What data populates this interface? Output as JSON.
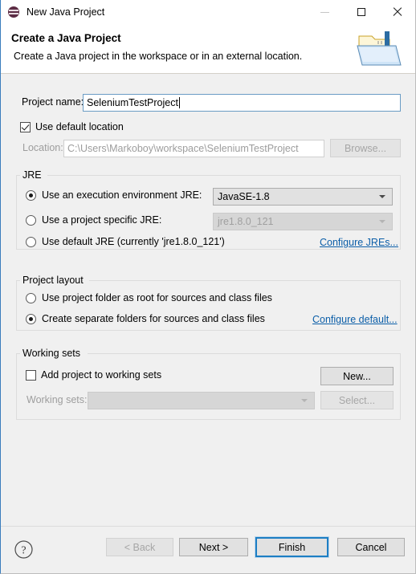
{
  "window": {
    "title": "New Java Project",
    "icon": "eclipse-logo-icon",
    "controls": {
      "minimize": "minimize-icon",
      "maximize": "maximize-icon",
      "close": "close-icon"
    }
  },
  "header": {
    "title": "Create a Java Project",
    "description": "Create a Java project in the workspace or in an external location.",
    "icon": "java-project-folder-icon"
  },
  "project_name": {
    "label": "Project name:",
    "value": "SeleniumTestProject"
  },
  "default_location": {
    "label": "Use default location",
    "checked": true
  },
  "location": {
    "label": "Location:",
    "value": "C:\\Users\\Markoboy\\workspace\\SeleniumTestProject",
    "browse_label": "Browse...",
    "enabled": false
  },
  "jre": {
    "legend": "JRE",
    "options": [
      {
        "label": "Use an execution environment JRE:",
        "selected": true
      },
      {
        "label": "Use a project specific JRE:",
        "selected": false
      },
      {
        "label": "Use default JRE (currently 'jre1.8.0_121')",
        "selected": false
      }
    ],
    "execution_environment": {
      "value": "JavaSE-1.8",
      "enabled": true
    },
    "specific_jre": {
      "value": "jre1.8.0_121",
      "enabled": false
    },
    "configure_link": "Configure JREs..."
  },
  "project_layout": {
    "legend": "Project layout",
    "options": [
      {
        "label": "Use project folder as root for sources and class files",
        "selected": false
      },
      {
        "label": "Create separate folders for sources and class files",
        "selected": true
      }
    ],
    "configure_link": "Configure default..."
  },
  "working_sets": {
    "legend": "Working sets",
    "add_checkbox": {
      "label": "Add project to working sets",
      "checked": false
    },
    "new_button": "New...",
    "sets_label": "Working sets:",
    "sets_value": "",
    "select_button": "Select...",
    "enabled": false
  },
  "footer": {
    "help_icon": "help-question-icon",
    "back_label": "< Back",
    "next_label": "Next >",
    "finish_label": "Finish",
    "cancel_label": "Cancel",
    "back_enabled": false,
    "finish_default": true
  },
  "colors": {
    "accent_blue": "#1d7ec4",
    "link_blue": "#0b5ea8",
    "dialog_bg": "#f0f0f0",
    "header_bg": "#ffffff"
  }
}
